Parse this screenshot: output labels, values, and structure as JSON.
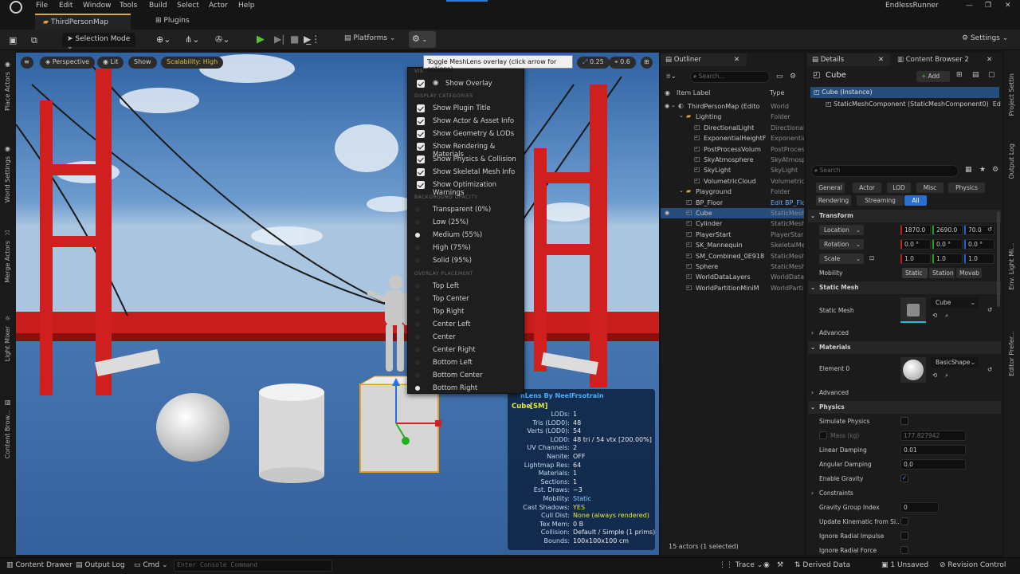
{
  "menubar": {
    "items": [
      "File",
      "Edit",
      "Window",
      "Tools",
      "Build",
      "Select",
      "Actor",
      "Help"
    ],
    "project": "EndlessRunner"
  },
  "tabs": [
    {
      "label": "ThirdPersonMap"
    },
    {
      "label": "Plugins"
    }
  ],
  "toolbar": {
    "selection_mode": "Selection Mode",
    "platforms": "Platforms",
    "settings": "Settings"
  },
  "tooltip": "Toggle MeshLens overlay (click arrow for options)",
  "viewport": {
    "perspective": "Perspective",
    "lit": "Lit",
    "show": "Show",
    "scalability": "Scalability: High",
    "camera_speed": "0.25",
    "fov": "0.6"
  },
  "dropdown": {
    "partial_header": "VIS",
    "show_overlay": "Show Overlay",
    "display_header": "DISPLAY CATEGORIES",
    "display": [
      "Show Plugin Title",
      "Show Actor & Asset Info",
      "Show Geometry & LODs",
      "Show Rendering & Materials",
      "Show Physics & Collision",
      "Show Skeletal Mesh Info",
      "Show Optimization Warnings"
    ],
    "opacity_header": "BACKGROUND OPACITY",
    "opacity": [
      "Transparent (0%)",
      "Low (25%)",
      "Medium (55%)",
      "High (75%)",
      "Solid (95%)"
    ],
    "opacity_selected": 2,
    "placement_header": "OVERLAY PLACEMENT",
    "placement": [
      "Top Left",
      "Top Center",
      "Top Right",
      "Center Left",
      "Center",
      "Center Right",
      "Bottom Left",
      "Bottom Center",
      "Bottom Right"
    ],
    "placement_selected": 8
  },
  "meshlens": {
    "title": "hLens By NeelFrsotrain",
    "object": "Cube",
    "tag": "[SM]",
    "rows": [
      {
        "k": "LODs:",
        "v": "1"
      },
      {
        "k": "Tris (LOD0):",
        "v": "48"
      },
      {
        "k": "Verts (LOD0):",
        "v": "54"
      },
      {
        "k": "LOD0:",
        "v": "48 tri / 54 vtx  [200.00%]"
      },
      {
        "k": "UV Channels:",
        "v": "2"
      },
      {
        "k": "Nanite:",
        "v": "OFF"
      },
      {
        "k": "Lightmap Res:",
        "v": "64"
      },
      {
        "k": "Materials:",
        "v": "1"
      },
      {
        "k": "Sections:",
        "v": "1"
      },
      {
        "k": "Est. Draws:",
        "v": "~3"
      },
      {
        "k": "Mobility:",
        "v": "Static"
      },
      {
        "k": "Cast Shadows:",
        "v": "YES"
      },
      {
        "k": "Cull Dist:",
        "v": "None (always rendered)"
      },
      {
        "k": "Tex Mem:",
        "v": "0 B"
      },
      {
        "k": "Collision:",
        "v": "Default / Simple  (1 prims)"
      },
      {
        "k": "Bounds:",
        "v": "100x100x100 cm"
      }
    ]
  },
  "outliner": {
    "title": "Outliner",
    "search_placeholder": "Search...",
    "col_label": "Item Label",
    "col_type": "Type",
    "rows": [
      {
        "label": "ThirdPersonMap (Edito",
        "type": "World",
        "indent": 0
      },
      {
        "label": "Lighting",
        "type": "Folder",
        "indent": 1
      },
      {
        "label": "DirectionalLight",
        "type": "Directional",
        "indent": 2
      },
      {
        "label": "ExponentialHeightF",
        "type": "Exponentia",
        "indent": 2
      },
      {
        "label": "PostProcessVolum",
        "type": "PostProces",
        "indent": 2
      },
      {
        "label": "SkyAtmosphere",
        "type": "SkyAtmosp",
        "indent": 2
      },
      {
        "label": "SkyLight",
        "type": "SkyLight",
        "indent": 2
      },
      {
        "label": "VolumetricCloud",
        "type": "Volumetric",
        "indent": 2
      },
      {
        "label": "Playground",
        "type": "Folder",
        "indent": 1
      },
      {
        "label": "BP_Floor",
        "type": "Edit BP_Flo",
        "indent": 1
      },
      {
        "label": "Cube",
        "type": "StaticMesh",
        "indent": 1
      },
      {
        "label": "Cylinder",
        "type": "StaticMesh",
        "indent": 1
      },
      {
        "label": "PlayerStart",
        "type": "PlayerStar",
        "indent": 1
      },
      {
        "label": "SK_Mannequin",
        "type": "SkeletalMe",
        "indent": 1
      },
      {
        "label": "SM_Combined_0E918",
        "type": "StaticMesh",
        "indent": 1
      },
      {
        "label": "Sphere",
        "type": "StaticMesh",
        "indent": 1
      },
      {
        "label": "WorldDataLayers",
        "type": "WorldDatal",
        "indent": 1
      },
      {
        "label": "WorldPartitionMiniM",
        "type": "WorldParti",
        "indent": 1
      }
    ],
    "footer": "15 actors (1 selected)"
  },
  "details": {
    "title": "Details",
    "content_browser": "Content Browser 2",
    "object": "Cube",
    "add": "Add",
    "instance": "Cube (Instance)",
    "component": "StaticMeshComponent (StaticMeshComponent0)",
    "edit": "Edi",
    "search_placeholder": "Search",
    "filters": [
      "General",
      "Actor",
      "LOD",
      "Misc",
      "Physics",
      "Rendering",
      "Streaming",
      "All"
    ],
    "transform": "Transform",
    "location": {
      "label": "Location",
      "x": "1870.0",
      "y": "2690.0",
      "z": "70.0"
    },
    "rotation": {
      "label": "Rotation",
      "x": "0.0 °",
      "y": "0.0 °",
      "z": "0.0 °"
    },
    "scale": {
      "label": "Scale",
      "x": "1.0",
      "y": "1.0",
      "z": "1.0"
    },
    "mobility": {
      "label": "Mobility",
      "options": [
        "Static",
        "Station",
        "Movab"
      ]
    },
    "static_mesh_section": "Static Mesh",
    "static_mesh_label": "Static Mesh",
    "static_mesh_value": "Cube",
    "advanced": "Advanced",
    "materials_section": "Materials",
    "element0": "Element 0",
    "material_value": "BasicShape",
    "physics_section": "Physics",
    "simulate_physics": "Simulate Physics",
    "mass": {
      "label": "Mass (kg)",
      "value": "177.827942"
    },
    "linear_damping": {
      "label": "Linear Damping",
      "value": "0.01"
    },
    "angular_damping": {
      "label": "Angular Damping",
      "value": "0.0"
    },
    "enable_gravity": "Enable Gravity",
    "constraints": "Constraints",
    "gravity_group": {
      "label": "Gravity Group Index",
      "value": "0"
    },
    "update_kinematic": "Update Kinematic from Si...",
    "ignore_radial_impulse": "Ignore Radial Impulse",
    "ignore_radial_force": "Ignore Radial Force"
  },
  "left_strip": [
    "Place Actors",
    "World Settings",
    "Merge Actors",
    "Light Mixer",
    "Content Brow..."
  ],
  "right_strip": [
    "Project Settin",
    "Output Log",
    "Env. Light Mi...",
    "Editor Prefer..."
  ],
  "statusbar": {
    "content_drawer": "Content Drawer",
    "output_log": "Output Log",
    "cmd": "Cmd",
    "console_placeholder": "Enter Console Command",
    "trace": "Trace",
    "derived_data": "Derived Data",
    "unsaved": "1 Unsaved",
    "revision": "Revision Control"
  }
}
